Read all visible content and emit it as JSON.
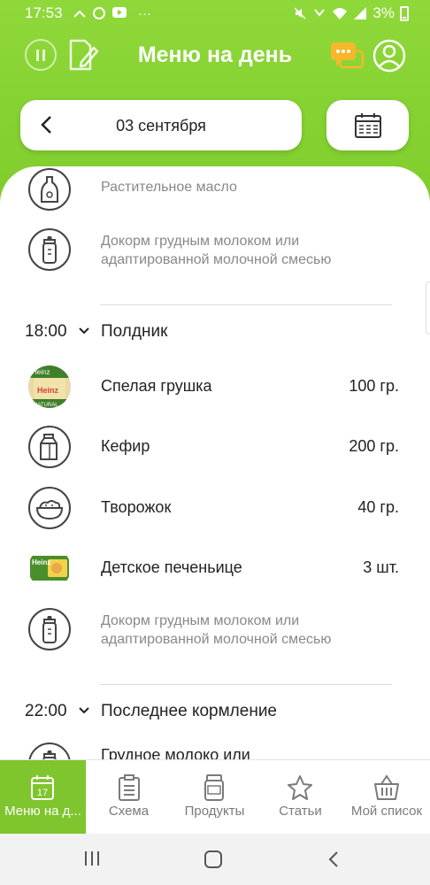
{
  "status_bar": {
    "time": "17:53",
    "battery": "3%",
    "more": "···"
  },
  "header": {
    "title": "Меню на день",
    "date": "03 сентября"
  },
  "items_top": [
    {
      "name": "Растительное масло",
      "icon": "oil-bottle-icon"
    },
    {
      "name": "Докорм грудным молоком или адаптированной молочной смесью",
      "icon": "baby-bottle-icon"
    }
  ],
  "meals": [
    {
      "time": "18:00",
      "title": "Полдник",
      "items": [
        {
          "name": "Спелая грушка",
          "qty": "100 гр.",
          "icon": "heinz-pear-jar-photo",
          "photo_label": "Heinz",
          "photo_label_2": "NATURAL"
        },
        {
          "name": "Кефир",
          "qty": "200 гр.",
          "icon": "milk-carton-icon"
        },
        {
          "name": "Творожок",
          "qty": "40 гр.",
          "icon": "bowl-icon"
        },
        {
          "name": "Детское печеньице",
          "qty": "3 шт.",
          "icon": "heinz-cookies-photo",
          "photo_label": "Heinz"
        },
        {
          "name": "Докорм грудным молоком или адаптированной молочной смесью",
          "qty": "",
          "icon": "baby-bottle-icon"
        }
      ]
    },
    {
      "time": "22:00",
      "title": "Последнее кормление",
      "items": [
        {
          "name": "Грудное молоко или",
          "icon": "baby-bottle-icon"
        }
      ]
    }
  ],
  "nav": {
    "items": [
      {
        "label": "Меню на д...",
        "icon": "calendar-icon",
        "badge": "17",
        "active": true
      },
      {
        "label": "Схема",
        "icon": "clipboard-icon",
        "active": false
      },
      {
        "label": "Продукты",
        "icon": "jar-icon",
        "active": false
      },
      {
        "label": "Статьи",
        "icon": "star-icon",
        "active": false
      },
      {
        "label": "Мой список",
        "icon": "basket-icon",
        "active": false
      }
    ]
  },
  "colors": {
    "accent": "#7fc52d",
    "header": "#8fd83a",
    "chat": "#f5b82a"
  }
}
